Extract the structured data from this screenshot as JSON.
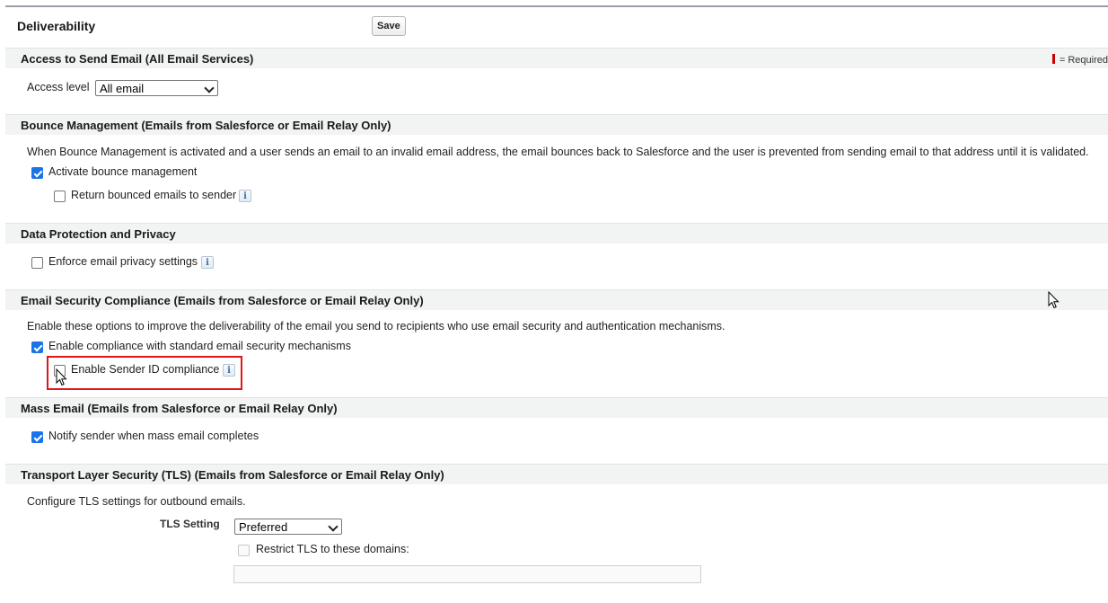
{
  "header": {
    "title": "Deliverability",
    "save_label": "Save",
    "required_legend": "= Required"
  },
  "sections": {
    "access": {
      "title": "Access to Send Email (All Email Services)",
      "access_level_label": "Access level",
      "access_level_value": "All email"
    },
    "bounce": {
      "title": "Bounce Management (Emails from Salesforce or Email Relay Only)",
      "description": "When Bounce Management is activated and a user sends an email to an invalid email address, the email bounces back to Salesforce and the user is prevented from sending email to that address until it is validated.",
      "activate_label": "Activate bounce management",
      "activate_checked": true,
      "return_label": "Return bounced emails to sender",
      "return_checked": false
    },
    "privacy": {
      "title": "Data Protection and Privacy",
      "enforce_label": "Enforce email privacy settings",
      "enforce_checked": false
    },
    "security": {
      "title": "Email Security Compliance (Emails from Salesforce or Email Relay Only)",
      "description": "Enable these options to improve the deliverability of the email you send to recipients who use email security and authentication mechanisms.",
      "compliance_label": "Enable compliance with standard email security mechanisms",
      "compliance_checked": true,
      "sender_id_label": "Enable Sender ID compliance",
      "sender_id_checked": false
    },
    "mass": {
      "title": "Mass Email (Emails from Salesforce or Email Relay Only)",
      "notify_label": "Notify sender when mass email completes",
      "notify_checked": true
    },
    "tls": {
      "title": "Transport Layer Security (TLS) (Emails from Salesforce or Email Relay Only)",
      "description": "Configure TLS settings for outbound emails.",
      "setting_label": "TLS Setting",
      "setting_value": "Preferred",
      "restrict_label": "Restrict TLS to these domains:",
      "restrict_checked": false,
      "domains_value": ""
    }
  },
  "info_glyph": "i",
  "colors": {
    "section_bg": "#f2f3f3",
    "checkbox_checked": "#1a73e8",
    "highlight": "#e0161b",
    "required_bar": "#cc0000"
  }
}
